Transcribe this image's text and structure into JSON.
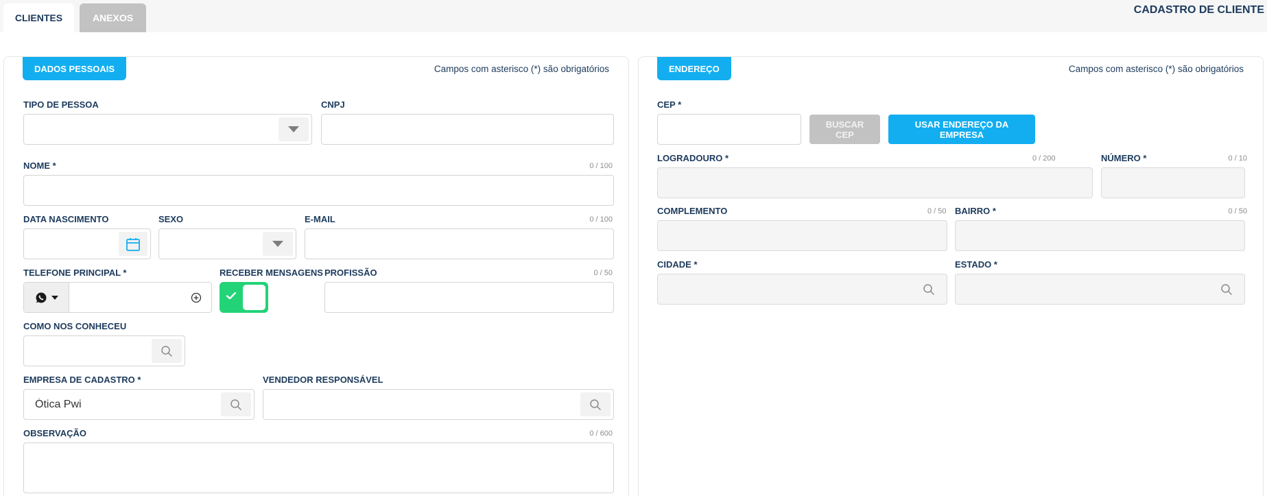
{
  "tabs": [
    {
      "label": "CLIENTES",
      "active": true
    },
    {
      "label": "ANEXOS",
      "active": false
    }
  ],
  "page_title": "CADASTRO DE CLIENTE",
  "required_note": "Campos com asterisco (*) são obrigatórios",
  "colors": {
    "accent": "#12aef0",
    "toggle_on": "#22d377",
    "disabled": "#c2c2c2",
    "text": "#1c3a5c"
  },
  "dados_pessoais": {
    "section_label": "DADOS PESSOAIS",
    "tipo_pessoa": {
      "label": "TIPO DE PESSOA",
      "value": ""
    },
    "cnpj": {
      "label": "CNPJ",
      "value": ""
    },
    "nome": {
      "label": "NOME *",
      "counter": "0 / 100",
      "value": ""
    },
    "data_nascimento": {
      "label": "DATA NASCIMENTO",
      "value": ""
    },
    "sexo": {
      "label": "SEXO",
      "value": ""
    },
    "email": {
      "label": "E-MAIL",
      "counter": "0 / 100",
      "value": ""
    },
    "telefone": {
      "label": "TELEFONE PRINCIPAL *",
      "value": ""
    },
    "receber_mensagens": {
      "label": "RECEBER MENSAGENS",
      "on": true
    },
    "profissao": {
      "label": "PROFISSÃO",
      "counter": "0 / 50",
      "value": ""
    },
    "como_conheceu": {
      "label": "COMO NOS CONHECEU",
      "value": ""
    },
    "empresa": {
      "label": "EMPRESA DE CADASTRO *",
      "value": "Ótica Pwi"
    },
    "vendedor": {
      "label": "VENDEDOR RESPONSÁVEL",
      "value": ""
    },
    "observacao": {
      "label": "OBSERVAÇÃO",
      "counter": "0 / 600",
      "value": ""
    }
  },
  "endereco": {
    "section_label": "ENDEREÇO",
    "cep": {
      "label": "CEP *",
      "value": ""
    },
    "buscar_cep_label": "BUSCAR CEP",
    "usar_endereco_label": "USAR ENDEREÇO DA EMPRESA",
    "logradouro": {
      "label": "LOGRADOURO *",
      "counter": "0 / 200",
      "value": ""
    },
    "numero": {
      "label": "NÚMERO *",
      "counter": "0 / 10",
      "value": ""
    },
    "complemento": {
      "label": "COMPLEMENTO",
      "counter": "0 / 50",
      "value": ""
    },
    "bairro": {
      "label": "BAIRRO *",
      "counter": "0 / 50",
      "value": ""
    },
    "cidade": {
      "label": "CIDADE *",
      "value": ""
    },
    "estado": {
      "label": "ESTADO *",
      "value": ""
    }
  }
}
